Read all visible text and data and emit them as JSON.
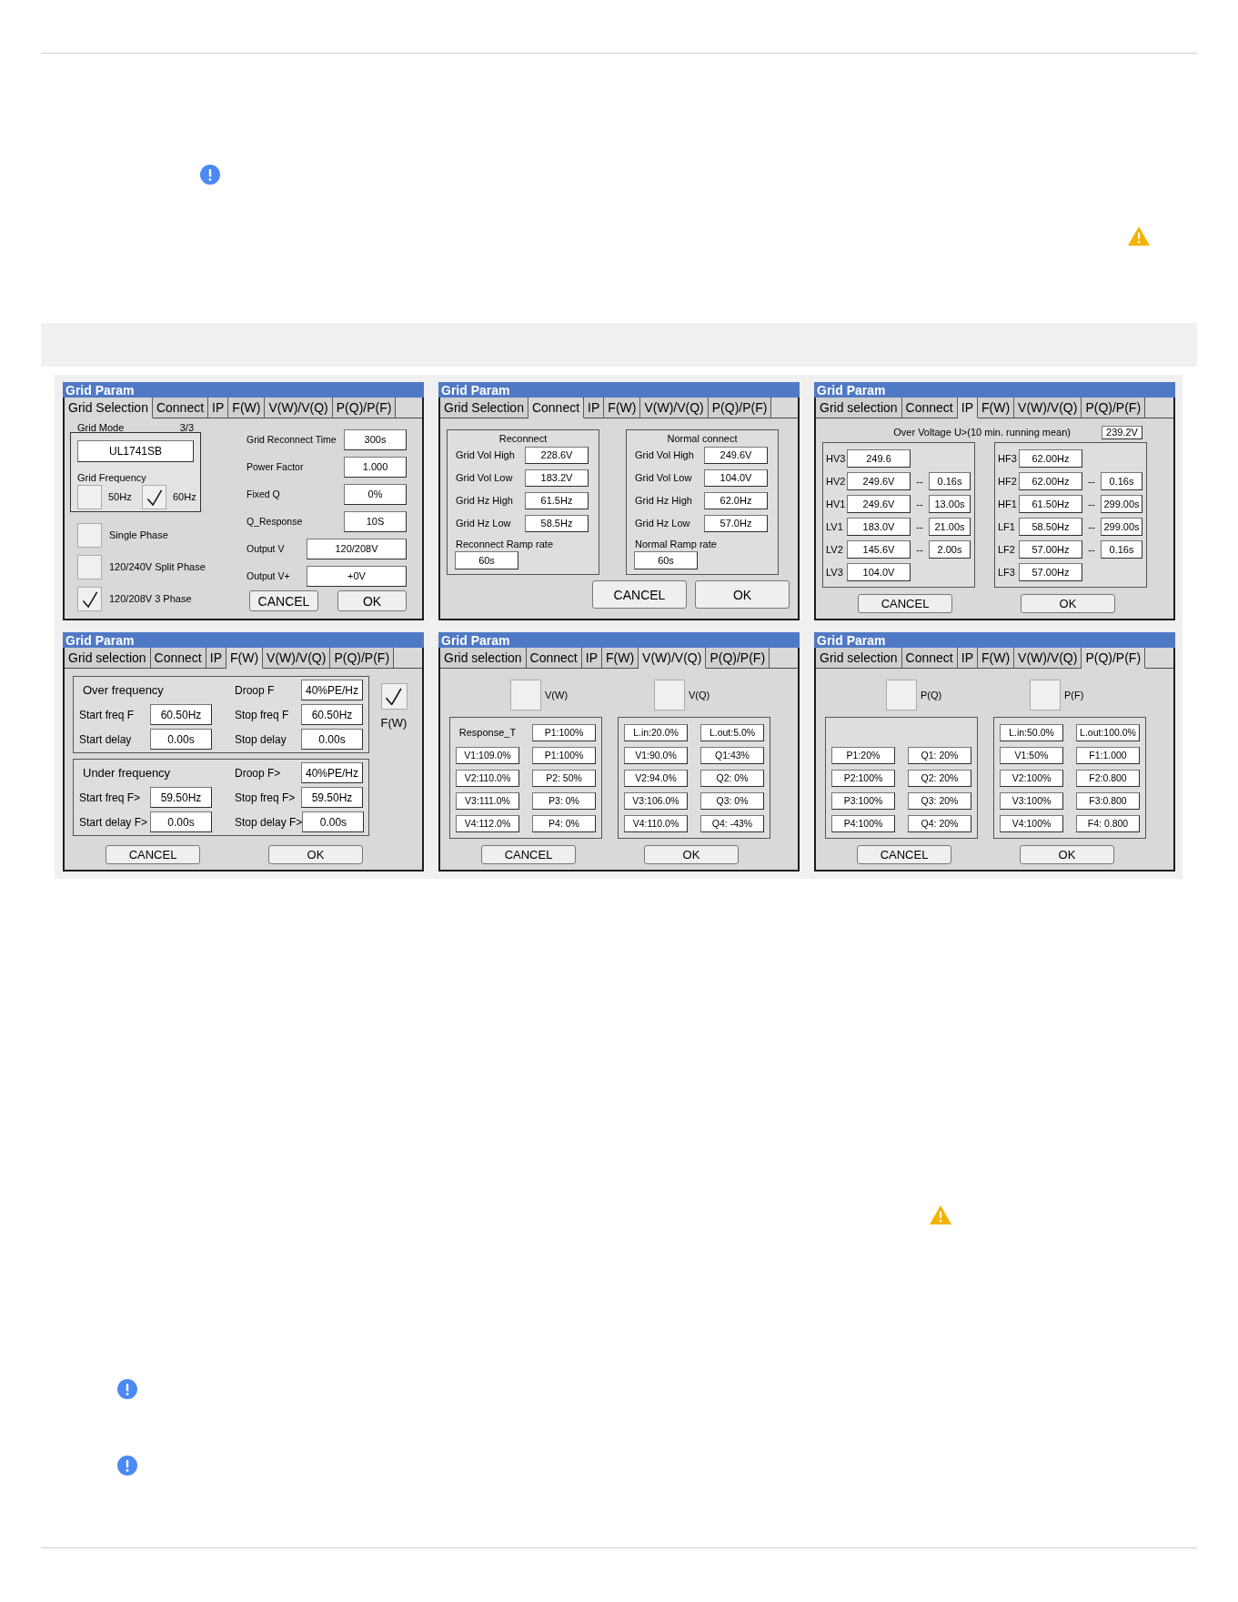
{
  "figure": {
    "panels": [
      {
        "title": "Grid Param",
        "kind": "grid_selection",
        "tabs": [
          {
            "label": "Grid Selection",
            "selected": true
          },
          {
            "label": "Connect",
            "selected": false
          },
          {
            "label": "IP",
            "selected": false
          },
          {
            "label": "F(W)",
            "selected": false
          },
          {
            "label": "V(W)/V(Q)",
            "selected": false
          },
          {
            "label": "P(Q)/P(F)",
            "selected": false
          }
        ],
        "grid_mode": {
          "label": "Grid Mode",
          "counter": "3/3",
          "value": "UL1741SB"
        },
        "grid_frequency": {
          "label": "Grid Frequency",
          "options": [
            {
              "label": "50Hz",
              "checked": false
            },
            {
              "label": "60Hz",
              "checked": true
            }
          ]
        },
        "phases": [
          {
            "label": "Single Phase",
            "checked": false
          },
          {
            "label": "120/240V Split Phase",
            "checked": false
          },
          {
            "label": "120/208V 3 Phase",
            "checked": true
          }
        ],
        "fields": [
          {
            "label": "Grid Reconnect Time",
            "value": "300s"
          },
          {
            "label": "Power Factor",
            "value": "1.000"
          },
          {
            "label": "Fixed Q",
            "value": "0%"
          },
          {
            "label": "Q_Response",
            "value": "10S"
          },
          {
            "label": "Output V",
            "value": "120/208V"
          },
          {
            "label": "Output V+",
            "value": "+0V"
          }
        ],
        "buttons": [
          "CANCEL",
          "OK"
        ]
      },
      {
        "title": "Grid Param",
        "kind": "connect",
        "tabs": [
          {
            "label": "Grid Selection",
            "selected": false
          },
          {
            "label": "Connect",
            "selected": true
          },
          {
            "label": "IP",
            "selected": false
          },
          {
            "label": "F(W)",
            "selected": false
          },
          {
            "label": "V(W)/V(Q)",
            "selected": false
          },
          {
            "label": "P(Q)/P(F)",
            "selected": false
          }
        ],
        "groups": [
          {
            "title": "Reconnect",
            "fields": [
              {
                "label": "Grid Vol High",
                "value": "228.6V"
              },
              {
                "label": "Grid Vol Low",
                "value": "183.2V"
              },
              {
                "label": "Grid Hz High",
                "value": "61.5Hz"
              },
              {
                "label": "Grid Hz Low",
                "value": "58.5Hz"
              }
            ],
            "ramp": {
              "label": "Reconnect Ramp rate",
              "value": "60s"
            }
          },
          {
            "title": "Normal connect",
            "fields": [
              {
                "label": "Grid Vol High",
                "value": "249.6V"
              },
              {
                "label": "Grid Vol Low",
                "value": "104.0V"
              },
              {
                "label": "Grid Hz High",
                "value": "62.0Hz"
              },
              {
                "label": "Grid Hz Low",
                "value": "57.0Hz"
              }
            ],
            "ramp": {
              "label": "Normal Ramp rate",
              "value": "60s"
            }
          }
        ],
        "buttons": [
          "CANCEL",
          "OK"
        ]
      },
      {
        "title": "Grid Param",
        "kind": "protection",
        "tabs": [
          {
            "label": "Grid selection",
            "selected": false
          },
          {
            "label": "Connect",
            "selected": false
          },
          {
            "label": "IP",
            "selected": true
          },
          {
            "label": "F(W)",
            "selected": false
          },
          {
            "label": "V(W)/V(Q)",
            "selected": false
          },
          {
            "label": "P(Q)/P(F)",
            "selected": false
          }
        ],
        "over_voltage": {
          "label": "Over Voltage U>(10 min. running mean)",
          "value": "239.2V"
        },
        "groups": [
          {
            "rows": [
              {
                "label": "HV3",
                "value": "249.6"
              },
              {
                "label": "HV2",
                "value": "249.6V",
                "separator": "--",
                "delay": "0.16s"
              },
              {
                "label": "HV1",
                "value": "249.6V",
                "separator": "--",
                "delay": "13.00s"
              },
              {
                "label": "LV1",
                "value": "183.0V",
                "separator": "--",
                "delay": "21.00s"
              },
              {
                "label": "LV2",
                "value": "145.6V",
                "separator": "--",
                "delay": "2.00s"
              },
              {
                "label": "LV3",
                "value": "104.0V"
              }
            ]
          },
          {
            "rows": [
              {
                "label": "HF3",
                "value": "62.00Hz"
              },
              {
                "label": "HF2",
                "value": "62.00Hz",
                "separator": "--",
                "delay": "0.16s"
              },
              {
                "label": "HF1",
                "value": "61.50Hz",
                "separator": "--",
                "delay": "299.00s"
              },
              {
                "label": "LF1",
                "value": "58.50Hz",
                "separator": "--",
                "delay": "299.00s"
              },
              {
                "label": "LF2",
                "value": "57.00Hz",
                "separator": "--",
                "delay": "0.16s"
              },
              {
                "label": "LF3",
                "value": "57.00Hz"
              }
            ]
          }
        ],
        "buttons": [
          "CANCEL",
          "OK"
        ]
      },
      {
        "title": "Grid Param",
        "kind": "frequency_watt",
        "tabs": [
          {
            "label": "Grid selection",
            "selected": false
          },
          {
            "label": "Connect",
            "selected": false
          },
          {
            "label": "IP",
            "selected": false
          },
          {
            "label": "F(W)",
            "selected": true
          },
          {
            "label": "V(W)/V(Q)",
            "selected": false
          },
          {
            "label": "P(Q)/P(F)",
            "selected": false
          }
        ],
        "groups": [
          {
            "title": "Over frequency",
            "fields": [
              {
                "label": "Droop F",
                "value": "40%PE/Hz"
              },
              {
                "label": "Start freq F",
                "value": "60.50Hz"
              },
              {
                "label": "Stop freq F",
                "value": "60.50Hz"
              },
              {
                "label": "Start delay",
                "value": "0.00s"
              },
              {
                "label": "Stop delay",
                "value": "0.00s"
              }
            ]
          },
          {
            "title": "Under frequency",
            "fields": [
              {
                "label": "Droop F>",
                "value": "40%PE/Hz"
              },
              {
                "label": "Start freq F>",
                "value": "59.50Hz"
              },
              {
                "label": "Stop freq F>",
                "value": "59.50Hz"
              },
              {
                "label": "Start delay F>",
                "value": "0.00s"
              },
              {
                "label": "Stop delay F>",
                "value": "0.00s"
              }
            ]
          }
        ],
        "enable": {
          "label": "F(W)",
          "checked": true
        },
        "buttons": [
          "CANCEL",
          "OK"
        ]
      },
      {
        "title": "Grid Param",
        "kind": "curves",
        "tabs": [
          {
            "label": "Grid selection",
            "selected": false
          },
          {
            "label": "Connect",
            "selected": false
          },
          {
            "label": "IP",
            "selected": false
          },
          {
            "label": "F(W)",
            "selected": false
          },
          {
            "label": "V(W)/V(Q)",
            "selected": true
          },
          {
            "label": "P(Q)/P(F)",
            "selected": false
          }
        ],
        "toggles": [
          {
            "label": "V(W)",
            "checked": false
          },
          {
            "label": "V(Q)",
            "checked": false
          }
        ],
        "groups": [
          {
            "cells": [
              {
                "kind": "text",
                "text": "Response_T"
              },
              {
                "kind": "field",
                "text": "P1:100%"
              },
              {
                "kind": "field",
                "text": "V1:109.0%"
              },
              {
                "kind": "field",
                "text": "P1:100%"
              },
              {
                "kind": "field",
                "text": "V2:110.0%"
              },
              {
                "kind": "field",
                "text": "P2: 50%"
              },
              {
                "kind": "field",
                "text": "V3:111.0%"
              },
              {
                "kind": "field",
                "text": "P3: 0%"
              },
              {
                "kind": "field",
                "text": "V4:112.0%"
              },
              {
                "kind": "field",
                "text": "P4: 0%"
              }
            ]
          },
          {
            "cells": [
              {
                "kind": "field",
                "text": "L.in:20.0%"
              },
              {
                "kind": "field",
                "text": "L.out:5.0%"
              },
              {
                "kind": "field",
                "text": "V1:90.0%"
              },
              {
                "kind": "field",
                "text": "Q1:43%"
              },
              {
                "kind": "field",
                "text": "V2:94.0%"
              },
              {
                "kind": "field",
                "text": "Q2: 0%"
              },
              {
                "kind": "field",
                "text": "V3:106.0%"
              },
              {
                "kind": "field",
                "text": "Q3: 0%"
              },
              {
                "kind": "field",
                "text": "V4:110.0%"
              },
              {
                "kind": "field",
                "text": "Q4: -43%"
              }
            ]
          }
        ],
        "buttons": [
          "CANCEL",
          "OK"
        ]
      },
      {
        "title": "Grid Param",
        "kind": "curves",
        "tabs": [
          {
            "label": "Grid selection",
            "selected": false
          },
          {
            "label": "Connect",
            "selected": false
          },
          {
            "label": "IP",
            "selected": false
          },
          {
            "label": "F(W)",
            "selected": false
          },
          {
            "label": "V(W)/V(Q)",
            "selected": false
          },
          {
            "label": "P(Q)/P(F)",
            "selected": true
          }
        ],
        "toggles": [
          {
            "label": "P(Q)",
            "checked": false
          },
          {
            "label": "P(F)",
            "checked": false
          }
        ],
        "groups": [
          {
            "cells": [
              {
                "kind": "field",
                "text": "P1:20%"
              },
              {
                "kind": "field",
                "text": "Q1: 20%"
              },
              {
                "kind": "field",
                "text": "P2:100%"
              },
              {
                "kind": "field",
                "text": "Q2: 20%"
              },
              {
                "kind": "field",
                "text": "P3:100%"
              },
              {
                "kind": "field",
                "text": "Q3: 20%"
              },
              {
                "kind": "field",
                "text": "P4:100%"
              },
              {
                "kind": "field",
                "text": "Q4: 20%"
              }
            ]
          },
          {
            "cells": [
              {
                "kind": "field",
                "text": "L.in:50.0%"
              },
              {
                "kind": "field",
                "text": "L.out:100.0%"
              },
              {
                "kind": "field",
                "text": "V1:50%"
              },
              {
                "kind": "field",
                "text": "F1:1.000"
              },
              {
                "kind": "field",
                "text": "V2:100%"
              },
              {
                "kind": "field",
                "text": "F2:0.800"
              },
              {
                "kind": "field",
                "text": "V3:100%"
              },
              {
                "kind": "field",
                "text": "F3:0.800"
              },
              {
                "kind": "field",
                "text": "V4:100%"
              },
              {
                "kind": "field",
                "text": "F4: 0.800"
              }
            ]
          }
        ],
        "buttons": [
          "CANCEL",
          "OK"
        ]
      }
    ]
  }
}
